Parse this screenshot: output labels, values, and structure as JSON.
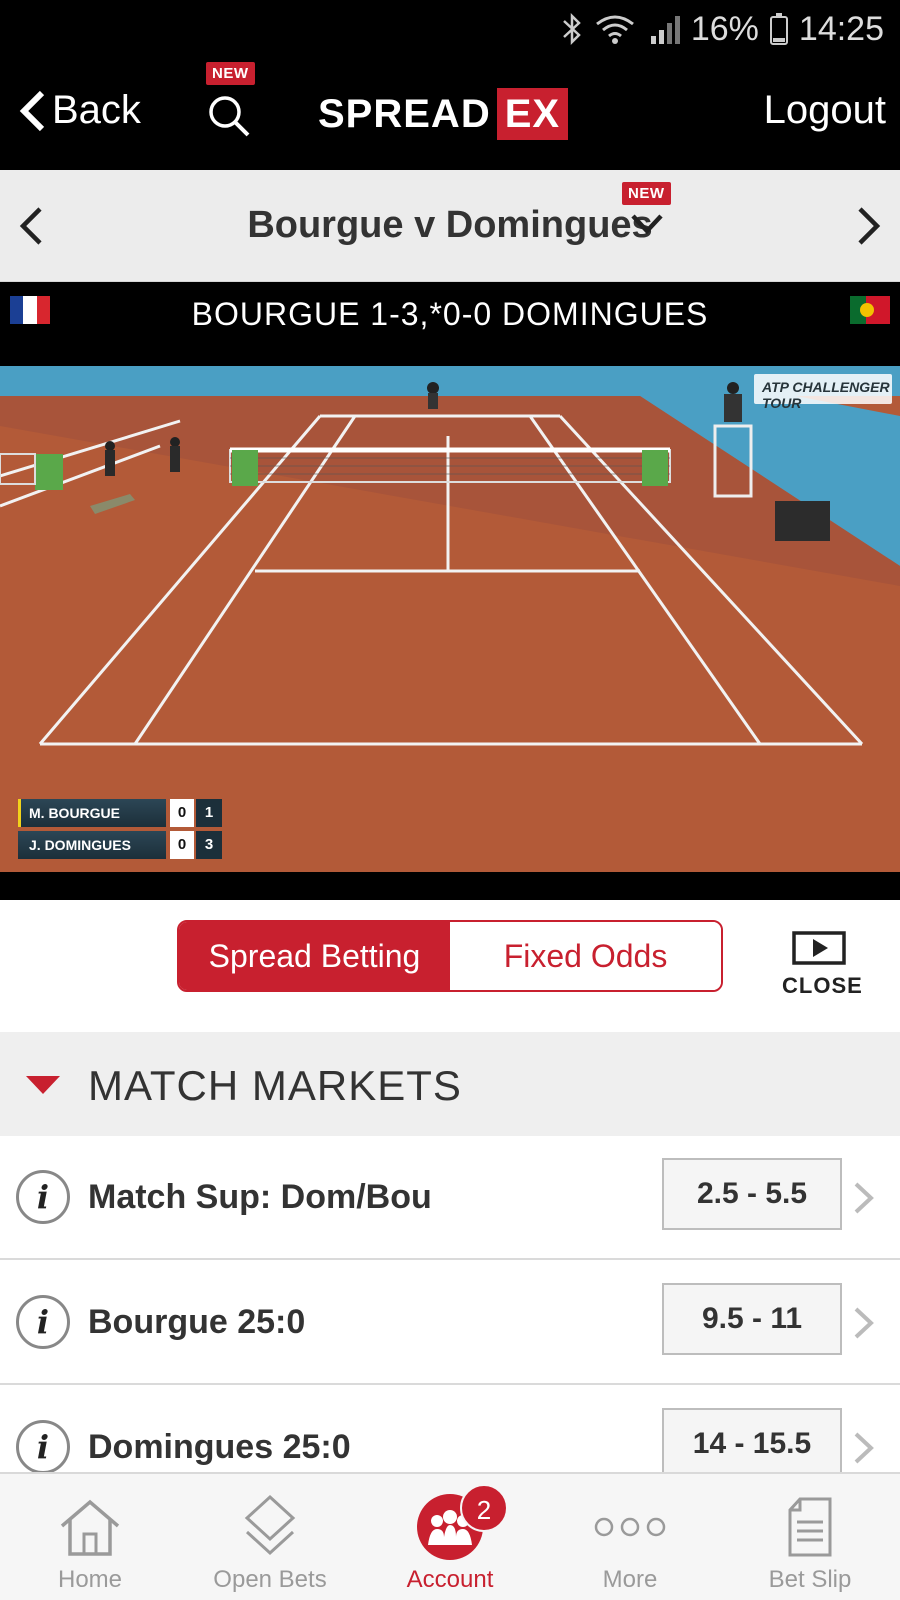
{
  "status_bar": {
    "battery": "16%",
    "time": "14:25"
  },
  "header": {
    "back_label": "Back",
    "search_badge": "NEW",
    "logo_part1": "SPREAD",
    "logo_part2": "EX",
    "logout_label": "Logout"
  },
  "match": {
    "title": "Bourgue v Domingues",
    "dropdown_badge": "NEW",
    "score_line": "BOURGUE 1-3,*0-0 DOMINGUES"
  },
  "video": {
    "atp_label": "ATP CHALLENGER TOUR",
    "scoreboard": [
      {
        "player": "M. BOURGUE",
        "set": "0",
        "game": "1"
      },
      {
        "player": "J. DOMINGUES",
        "set": "0",
        "game": "3"
      }
    ]
  },
  "mode_toggle": {
    "spread_label": "Spread Betting",
    "fixed_label": "Fixed Odds",
    "close_label": "CLOSE"
  },
  "markets": {
    "heading": "MATCH MARKETS",
    "rows": [
      {
        "name": "Match Sup: Dom/Bou",
        "price": "2.5 - 5.5"
      },
      {
        "name": "Bourgue 25:0",
        "price": "9.5 - 11"
      },
      {
        "name": "Domingues 25:0",
        "price": "14 - 15.5"
      }
    ]
  },
  "tabbar": {
    "home": "Home",
    "open_bets": "Open Bets",
    "account": "Account",
    "account_count": "2",
    "more": "More",
    "bet_slip": "Bet Slip"
  },
  "colors": {
    "brand": "#c8202f",
    "header_bg": "#000000",
    "clay": "#b45a36"
  }
}
